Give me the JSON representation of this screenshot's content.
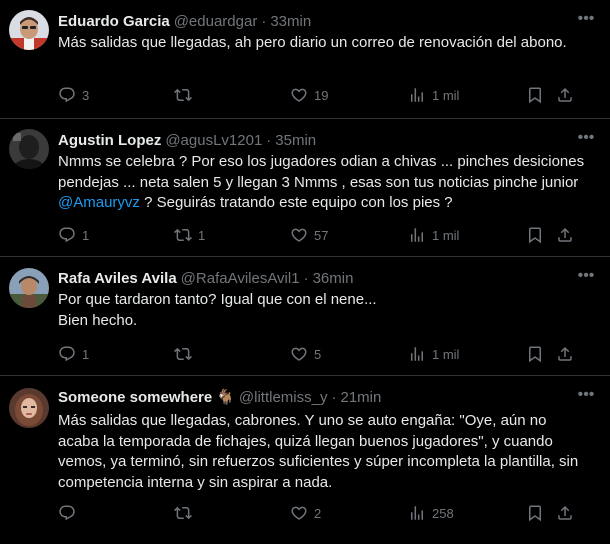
{
  "tweets": [
    {
      "name": "Eduardo Garcia",
      "handle": "@eduardgar",
      "dot": "·",
      "time": "33min",
      "body": "Más salidas que llegadas, ah pero diario un correo de renovación del abono.",
      "replies": "3",
      "retweets": "",
      "likes": "19",
      "views": "1 mil"
    },
    {
      "name": "Agustin Lopez",
      "handle": "@agusLv1201",
      "dot": "·",
      "time": "35min",
      "body_before": "Nmms se celebra ? Por eso los jugadores odian a chivas ... pinches desiciones pendejas ... neta salen 5 y llegan 3 Nmms , esas son tus noticias pinche junior ",
      "mention": "@Amauryvz",
      "body_after": " ? Seguirás tratando este equipo con los pies ?",
      "replies": "1",
      "retweets": "1",
      "likes": "57",
      "views": "1 mil"
    },
    {
      "name": "Rafa Aviles Avila",
      "handle": "@RafaAvilesAvil1",
      "dot": "·",
      "time": "36min",
      "body_line1": "Por que tardaron tanto? Igual que con el nene...",
      "body_line2": "Bien hecho.",
      "replies": "1",
      "retweets": "",
      "likes": "5",
      "views": "1 mil"
    },
    {
      "name": "Someone somewhere",
      "name_emoji": "🐐",
      "handle": "@littlemiss_y",
      "dot": "·",
      "time": "21min",
      "body": "Más salidas que llegadas, cabrones. Y uno se auto engaña: \"Oye, aún no acaba la temporada de fichajes, quizá llegan buenos jugadores\", y cuando vemos, ya terminó, sin refuerzos suficientes y súper incompleta la plantilla, sin competencia interna y sin aspirar a nada.",
      "replies": "",
      "retweets": "",
      "likes": "2",
      "views": "258"
    }
  ],
  "icons": {
    "more": "more-horizontal-icon",
    "reply": "reply-icon",
    "retweet": "retweet-icon",
    "like": "heart-icon",
    "views": "views-chart-icon",
    "bookmark": "bookmark-icon",
    "share": "share-icon"
  },
  "colors": {
    "background": "#000000",
    "text": "#e7e9ea",
    "muted": "#71767b",
    "link": "#1d9bf0",
    "divider": "#2f3336"
  }
}
